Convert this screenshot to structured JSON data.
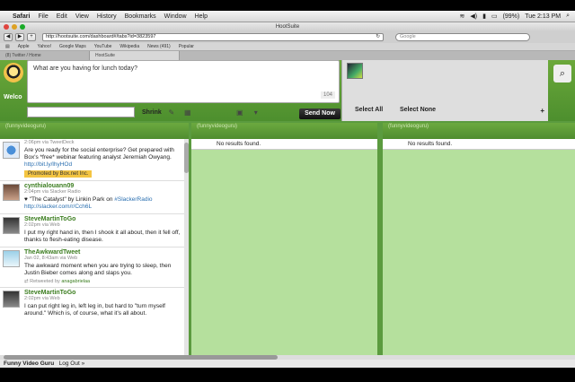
{
  "menubar": {
    "items": [
      "Safari",
      "File",
      "Edit",
      "View",
      "History",
      "Bookmarks",
      "Window",
      "Help"
    ],
    "battery": "(99%)",
    "clock": "Tue 2:13 PM"
  },
  "window": {
    "title": "HootSuite"
  },
  "toolbar": {
    "url": "http://hootsuite.com/dashboard#/tabs?id=3823597",
    "search_placeholder": "Google"
  },
  "bookmarks": [
    "Apple",
    "Yahoo!",
    "Google Maps",
    "YouTube",
    "Wikipedia",
    "News (491)",
    "Popular"
  ],
  "tabs": [
    "(8) Twitter / Home",
    "HootSuite"
  ],
  "composer": {
    "placeholder": "What are you having for lunch today?",
    "count": "104",
    "welcome": "Welco",
    "shrink_label": "Shrink",
    "send_label": "Send Now"
  },
  "profiles": {
    "select_all": "Select All",
    "select_none": "Select None"
  },
  "columns": [
    {
      "header": "(funnyvideoguru)",
      "tweets": [
        {
          "meta": "2:06pm via TweetDeck",
          "body": "Are you ready for the social enterprise? Get prepared with Box's *free* webinar featuring analyst Jeremiah Owyang.",
          "link": "http://bit.ly/lhyHOd",
          "promo": "Promoted by Box.net Inc."
        },
        {
          "user": "cynthialouann09",
          "meta": "2:04pm via Slacker Radio",
          "body": "♥ \"The Catalyst\" by Linkin Park on",
          "tag": "#SlackerRadio",
          "link": "http://slacker.com/r/Cch6L"
        },
        {
          "user": "SteveMartinToGo",
          "meta": "2:02pm via Web",
          "body": "I put my right hand in, then I shook it all about, then it fell off, thanks to flesh-eating disease."
        },
        {
          "user": "TheAwkwardTweet",
          "meta": "Jan 02, 8:43am via Web",
          "body": "The awkward moment when you are trying to sleep, then Justin Bieber comes along and slaps you.",
          "rt_label": "Retweeted by",
          "rt_user": "anagabrielaa"
        },
        {
          "user": "SteveMartinToGo",
          "meta": "2:02pm via Web",
          "body": "I can put right leg in, left leg in, but hard to \"turn myself around.\" Which is, of course, what it's all about."
        }
      ]
    },
    {
      "header": "(funnyvideoguru)",
      "empty": "No results found."
    },
    {
      "header": "(funnyvideoguru)",
      "empty": "No results found."
    }
  ],
  "footer": {
    "user": "Funny Video Guru",
    "logout": "Log Out »"
  },
  "colors": {
    "brand_green": "#5b9b3f",
    "column_green": "#b5e09d",
    "username_green": "#3b7d1f",
    "promo_yellow": "#f4c542"
  }
}
